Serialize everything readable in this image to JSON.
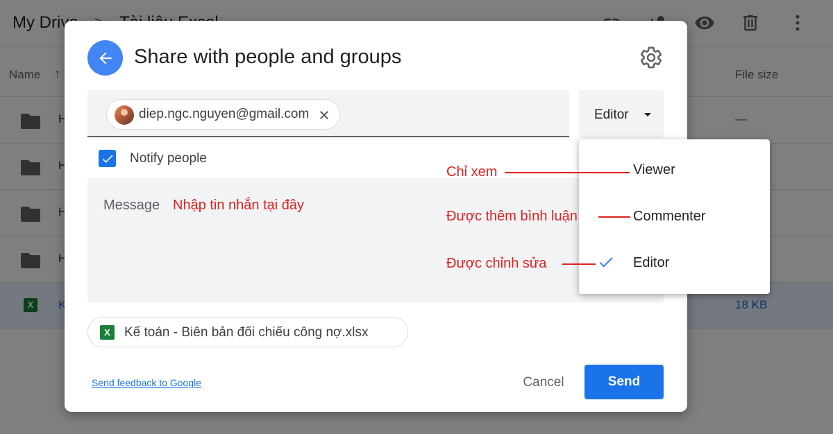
{
  "background": {
    "breadcrumb_root": "My Drive",
    "breadcrumb_sep": ">",
    "breadcrumb_current": "Tài liệu Excel",
    "column_name": "Name",
    "column_sort_arrow": "↑",
    "column_filesize": "File size",
    "rows": [
      {
        "name": "H",
        "size": "—",
        "icon": "folder-icon"
      },
      {
        "name": "H",
        "size": "",
        "icon": "folder-icon"
      },
      {
        "name": "H",
        "size": "",
        "icon": "folder-icon"
      },
      {
        "name": "H",
        "size": "",
        "icon": "folder-icon"
      },
      {
        "name": "K",
        "size": "18 KB",
        "icon": "excel-icon",
        "selected": true
      }
    ],
    "header_icons": [
      "link-icon",
      "add-person-icon",
      "eye-icon",
      "trash-icon",
      "more-vert-icon"
    ]
  },
  "dialog": {
    "title": "Share with people and groups",
    "recipient_email": "diep.ngc.nguyen@gmail.com",
    "role_selected": "Editor",
    "notify_label": "Notify people",
    "notify_checked": true,
    "message_placeholder": "Message",
    "file_icon_letter": "X",
    "file_name": "Kế toán - Biên bản đối chiếu công nợ.xlsx",
    "feedback_link": "Send feedback to Google",
    "cancel_label": "Cancel",
    "send_label": "Send",
    "accent_color": "#1a73e8"
  },
  "role_menu": {
    "items": [
      {
        "label": "Viewer",
        "checked": false
      },
      {
        "label": "Commenter",
        "checked": false
      },
      {
        "label": "Editor",
        "checked": true
      }
    ]
  },
  "annotations": {
    "message_note": "Nhập tin nhắn tại đây",
    "viewer_note": "Chỉ xem",
    "commenter_note": "Được thêm bình luận",
    "editor_note": "Được chỉnh sửa",
    "color": "#e02020"
  }
}
